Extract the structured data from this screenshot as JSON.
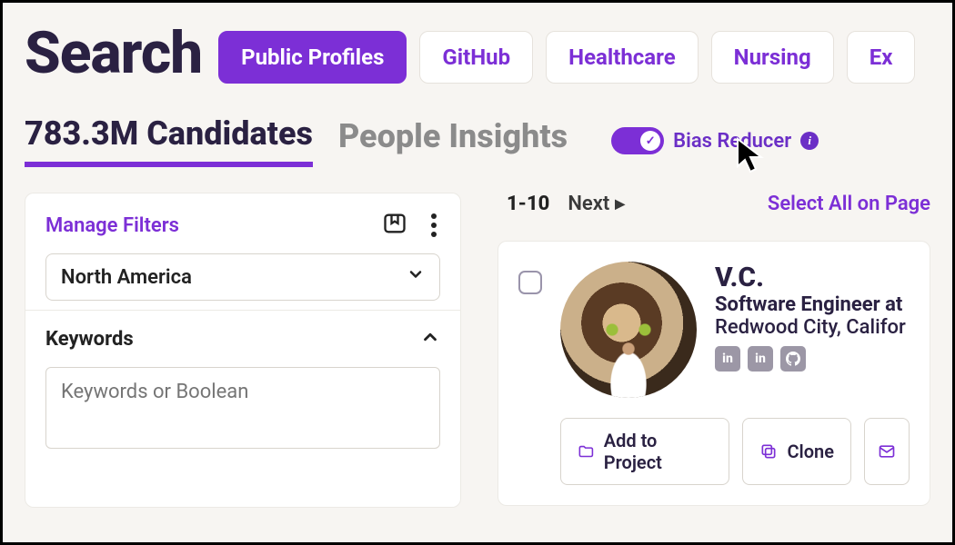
{
  "header": {
    "title": "Search",
    "chips": [
      "Public Profiles",
      "GitHub",
      "Healthcare",
      "Nursing",
      "Ex"
    ],
    "active_chip_index": 0
  },
  "tabs": {
    "candidates": "783.3M Candidates",
    "insights": "People Insights",
    "active": "candidates"
  },
  "bias_reducer": {
    "label": "Bias Reducer",
    "enabled": true
  },
  "filters": {
    "manage_label": "Manage Filters",
    "region": "North America",
    "keywords_label": "Keywords",
    "keywords_placeholder": "Keywords or Boolean"
  },
  "results": {
    "range": "1-10",
    "next_label": "Next",
    "select_all_label": "Select All on Page"
  },
  "candidate": {
    "name": "V.C.",
    "role": "Software Engineer at",
    "location": "Redwood City, Califor",
    "socials": [
      "in",
      "in",
      "gh"
    ],
    "actions": {
      "add_to_project": "Add to Project",
      "clone": "Clone"
    }
  }
}
